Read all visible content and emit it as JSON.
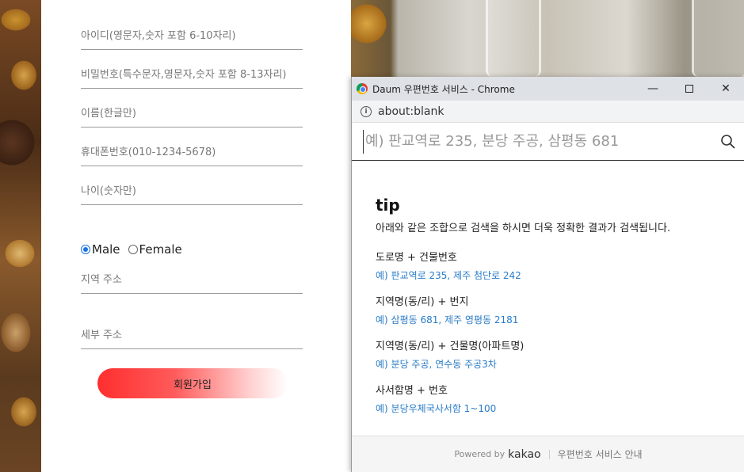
{
  "form": {
    "fields": [
      {
        "placeholder": "아이디(영문자,숫자 포함 6-10자리)"
      },
      {
        "placeholder": "비밀번호(특수문자,영문자,숫자 포함 8-13자리)"
      },
      {
        "placeholder": "이름(한글만)"
      },
      {
        "placeholder": "휴대폰번호(010-1234-5678)"
      },
      {
        "placeholder": "나이(숫자만)"
      }
    ],
    "gender": {
      "male": "Male",
      "female": "Female",
      "selected": "Male"
    },
    "region_address": "지역 주소",
    "detail_address": "세부 주소",
    "signup_label": "회원가입"
  },
  "popup": {
    "title": "Daum 우편번호 서비스 - Chrome",
    "url": "about:blank",
    "search_placeholder": "예) 판교역로 235, 분당 주공, 삼평동 681",
    "tip_title": "tip",
    "tip_desc": "아래와 같은 조합으로 검색을 하시면 더욱 정확한 결과가 검색됩니다.",
    "tips": [
      {
        "head": "도로명 + 건물번호",
        "example": "예) 판교역로 235,  제주 첨단로 242"
      },
      {
        "head": "지역명(동/리) + 번지",
        "example": "예) 삼평동 681,  제주 영평동 2181"
      },
      {
        "head": "지역명(동/리) + 건물명(아파트명)",
        "example": "예) 분당 주공,  연수동 주공3차"
      },
      {
        "head": "사서함명 + 번호",
        "example": "예) 분당우체국사서함 1~100"
      }
    ],
    "footer": {
      "powered_by": "Powered by",
      "brand": "kakao",
      "guide": "우편번호 서비스 안내"
    }
  }
}
